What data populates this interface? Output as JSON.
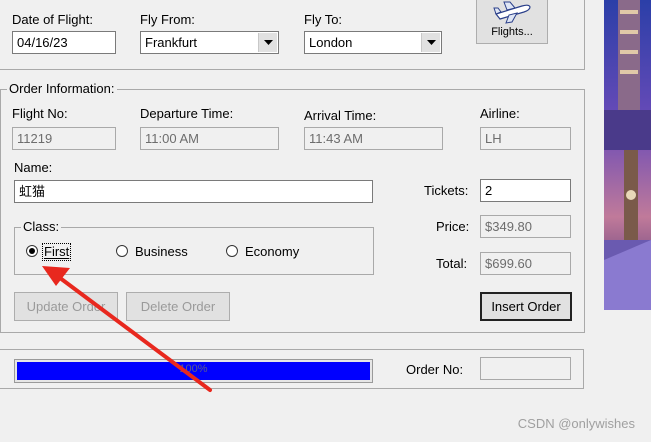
{
  "flight_search": {
    "date_label": "Date of Flight:",
    "date_value": "04/16/23",
    "from_label": "Fly From:",
    "from_value": "Frankfurt",
    "to_label": "Fly To:",
    "to_value": "London",
    "flights_button": "Flights..."
  },
  "order": {
    "group_title": "Order Information:",
    "flight_no_label": "Flight No:",
    "flight_no_value": "11219",
    "departure_label": "Departure Time:",
    "departure_value": "11:00 AM",
    "arrival_label": "Arrival Time:",
    "arrival_value": "11:43 AM",
    "airline_label": "Airline:",
    "airline_value": "LH",
    "name_label": "Name:",
    "name_value": "虹猫",
    "tickets_label": "Tickets:",
    "tickets_value": "2",
    "price_label": "Price:",
    "price_value": "$349.80",
    "total_label": "Total:",
    "total_value": "$699.60",
    "class_group_title": "Class:",
    "class_options": [
      "First",
      "Business",
      "Economy"
    ],
    "class_selected": "First",
    "update_button": "Update Order",
    "delete_button": "Delete Order",
    "insert_button": "Insert Order"
  },
  "status": {
    "progress_text": "100%",
    "progress_fraction": 1.0,
    "progress_color": "#0000ff",
    "order_no_label": "Order No:",
    "order_no_value": ""
  },
  "watermark": "CSDN @onlywishes",
  "annotation": {
    "arrow_color": "#e8281e"
  }
}
